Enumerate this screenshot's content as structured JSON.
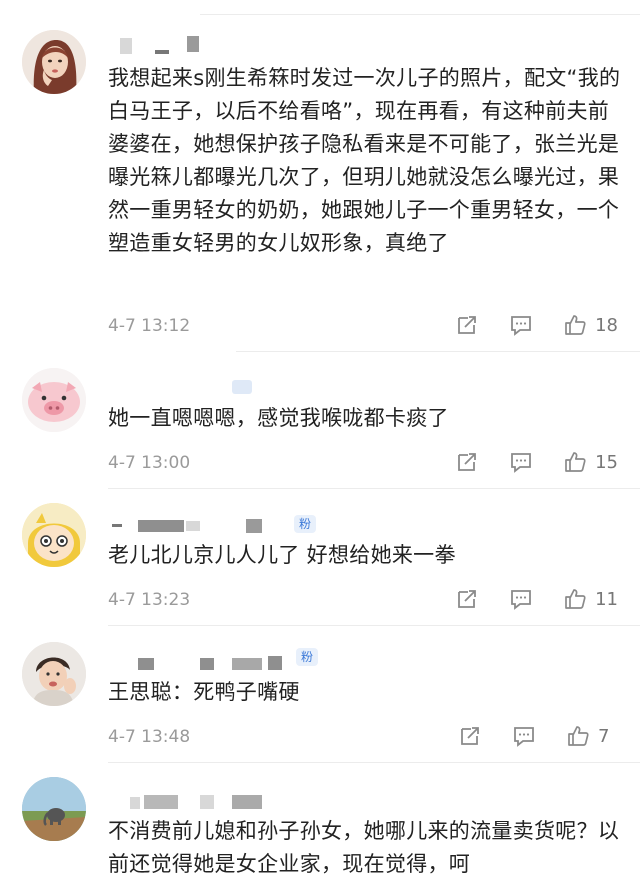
{
  "comments": [
    {
      "text": "我想起来s刚生希箖时发过一次儿子的照片，配文“我的白马王子，以后不给看咯”，现在再看，有这种前夫前婆婆在，她想保护孩子隐私看来是不可能了，张兰光是曝光箖儿都曝光几次了，但玥儿她就没怎么曝光过，果然一重男轻女的奶奶，她跟她儿子一个重男轻女，一个塑造重女轻男的女儿奴形象，真绝了",
      "time": "4-7 13:12",
      "likes": "18"
    },
    {
      "text": "她一直嗯嗯嗯，感觉我喉咙都卡痰了",
      "time": "4-7 13:00",
      "likes": "15"
    },
    {
      "text": "老儿北儿京儿人儿了 好想给她来一拳",
      "time": "4-7 13:23",
      "likes": "11",
      "badge": "粉"
    },
    {
      "text": "王思聪：死鸭子嘴硬",
      "time": "4-7 13:48",
      "likes": "7",
      "badge": "粉"
    },
    {
      "text": "不消费前儿媳和孙子孙女，她哪儿来的流量卖货呢？以前还觉得她是女企业家，现在觉得，呵"
    }
  ],
  "icons": {
    "share": "share-icon",
    "reply": "comment-icon",
    "like": "thumbs-up-icon"
  }
}
